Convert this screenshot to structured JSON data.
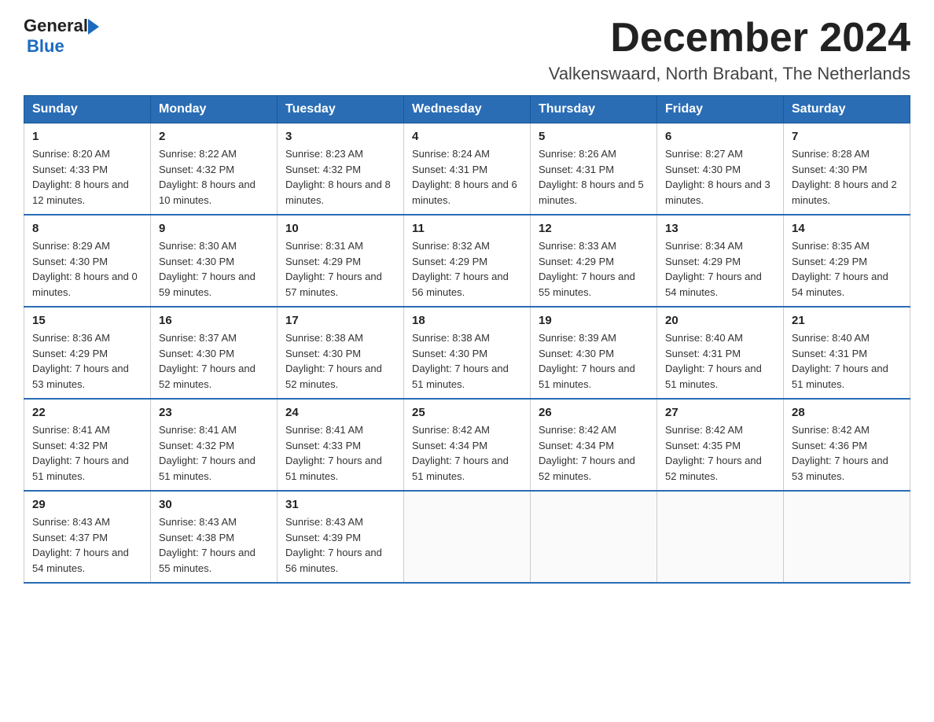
{
  "header": {
    "logo_general": "General",
    "logo_blue": "Blue",
    "title": "December 2024",
    "subtitle": "Valkenswaard, North Brabant, The Netherlands"
  },
  "weekdays": [
    "Sunday",
    "Monday",
    "Tuesday",
    "Wednesday",
    "Thursday",
    "Friday",
    "Saturday"
  ],
  "weeks": [
    [
      {
        "day": "1",
        "sunrise": "Sunrise: 8:20 AM",
        "sunset": "Sunset: 4:33 PM",
        "daylight": "Daylight: 8 hours and 12 minutes."
      },
      {
        "day": "2",
        "sunrise": "Sunrise: 8:22 AM",
        "sunset": "Sunset: 4:32 PM",
        "daylight": "Daylight: 8 hours and 10 minutes."
      },
      {
        "day": "3",
        "sunrise": "Sunrise: 8:23 AM",
        "sunset": "Sunset: 4:32 PM",
        "daylight": "Daylight: 8 hours and 8 minutes."
      },
      {
        "day": "4",
        "sunrise": "Sunrise: 8:24 AM",
        "sunset": "Sunset: 4:31 PM",
        "daylight": "Daylight: 8 hours and 6 minutes."
      },
      {
        "day": "5",
        "sunrise": "Sunrise: 8:26 AM",
        "sunset": "Sunset: 4:31 PM",
        "daylight": "Daylight: 8 hours and 5 minutes."
      },
      {
        "day": "6",
        "sunrise": "Sunrise: 8:27 AM",
        "sunset": "Sunset: 4:30 PM",
        "daylight": "Daylight: 8 hours and 3 minutes."
      },
      {
        "day": "7",
        "sunrise": "Sunrise: 8:28 AM",
        "sunset": "Sunset: 4:30 PM",
        "daylight": "Daylight: 8 hours and 2 minutes."
      }
    ],
    [
      {
        "day": "8",
        "sunrise": "Sunrise: 8:29 AM",
        "sunset": "Sunset: 4:30 PM",
        "daylight": "Daylight: 8 hours and 0 minutes."
      },
      {
        "day": "9",
        "sunrise": "Sunrise: 8:30 AM",
        "sunset": "Sunset: 4:30 PM",
        "daylight": "Daylight: 7 hours and 59 minutes."
      },
      {
        "day": "10",
        "sunrise": "Sunrise: 8:31 AM",
        "sunset": "Sunset: 4:29 PM",
        "daylight": "Daylight: 7 hours and 57 minutes."
      },
      {
        "day": "11",
        "sunrise": "Sunrise: 8:32 AM",
        "sunset": "Sunset: 4:29 PM",
        "daylight": "Daylight: 7 hours and 56 minutes."
      },
      {
        "day": "12",
        "sunrise": "Sunrise: 8:33 AM",
        "sunset": "Sunset: 4:29 PM",
        "daylight": "Daylight: 7 hours and 55 minutes."
      },
      {
        "day": "13",
        "sunrise": "Sunrise: 8:34 AM",
        "sunset": "Sunset: 4:29 PM",
        "daylight": "Daylight: 7 hours and 54 minutes."
      },
      {
        "day": "14",
        "sunrise": "Sunrise: 8:35 AM",
        "sunset": "Sunset: 4:29 PM",
        "daylight": "Daylight: 7 hours and 54 minutes."
      }
    ],
    [
      {
        "day": "15",
        "sunrise": "Sunrise: 8:36 AM",
        "sunset": "Sunset: 4:29 PM",
        "daylight": "Daylight: 7 hours and 53 minutes."
      },
      {
        "day": "16",
        "sunrise": "Sunrise: 8:37 AM",
        "sunset": "Sunset: 4:30 PM",
        "daylight": "Daylight: 7 hours and 52 minutes."
      },
      {
        "day": "17",
        "sunrise": "Sunrise: 8:38 AM",
        "sunset": "Sunset: 4:30 PM",
        "daylight": "Daylight: 7 hours and 52 minutes."
      },
      {
        "day": "18",
        "sunrise": "Sunrise: 8:38 AM",
        "sunset": "Sunset: 4:30 PM",
        "daylight": "Daylight: 7 hours and 51 minutes."
      },
      {
        "day": "19",
        "sunrise": "Sunrise: 8:39 AM",
        "sunset": "Sunset: 4:30 PM",
        "daylight": "Daylight: 7 hours and 51 minutes."
      },
      {
        "day": "20",
        "sunrise": "Sunrise: 8:40 AM",
        "sunset": "Sunset: 4:31 PM",
        "daylight": "Daylight: 7 hours and 51 minutes."
      },
      {
        "day": "21",
        "sunrise": "Sunrise: 8:40 AM",
        "sunset": "Sunset: 4:31 PM",
        "daylight": "Daylight: 7 hours and 51 minutes."
      }
    ],
    [
      {
        "day": "22",
        "sunrise": "Sunrise: 8:41 AM",
        "sunset": "Sunset: 4:32 PM",
        "daylight": "Daylight: 7 hours and 51 minutes."
      },
      {
        "day": "23",
        "sunrise": "Sunrise: 8:41 AM",
        "sunset": "Sunset: 4:32 PM",
        "daylight": "Daylight: 7 hours and 51 minutes."
      },
      {
        "day": "24",
        "sunrise": "Sunrise: 8:41 AM",
        "sunset": "Sunset: 4:33 PM",
        "daylight": "Daylight: 7 hours and 51 minutes."
      },
      {
        "day": "25",
        "sunrise": "Sunrise: 8:42 AM",
        "sunset": "Sunset: 4:34 PM",
        "daylight": "Daylight: 7 hours and 51 minutes."
      },
      {
        "day": "26",
        "sunrise": "Sunrise: 8:42 AM",
        "sunset": "Sunset: 4:34 PM",
        "daylight": "Daylight: 7 hours and 52 minutes."
      },
      {
        "day": "27",
        "sunrise": "Sunrise: 8:42 AM",
        "sunset": "Sunset: 4:35 PM",
        "daylight": "Daylight: 7 hours and 52 minutes."
      },
      {
        "day": "28",
        "sunrise": "Sunrise: 8:42 AM",
        "sunset": "Sunset: 4:36 PM",
        "daylight": "Daylight: 7 hours and 53 minutes."
      }
    ],
    [
      {
        "day": "29",
        "sunrise": "Sunrise: 8:43 AM",
        "sunset": "Sunset: 4:37 PM",
        "daylight": "Daylight: 7 hours and 54 minutes."
      },
      {
        "day": "30",
        "sunrise": "Sunrise: 8:43 AM",
        "sunset": "Sunset: 4:38 PM",
        "daylight": "Daylight: 7 hours and 55 minutes."
      },
      {
        "day": "31",
        "sunrise": "Sunrise: 8:43 AM",
        "sunset": "Sunset: 4:39 PM",
        "daylight": "Daylight: 7 hours and 56 minutes."
      },
      null,
      null,
      null,
      null
    ]
  ]
}
